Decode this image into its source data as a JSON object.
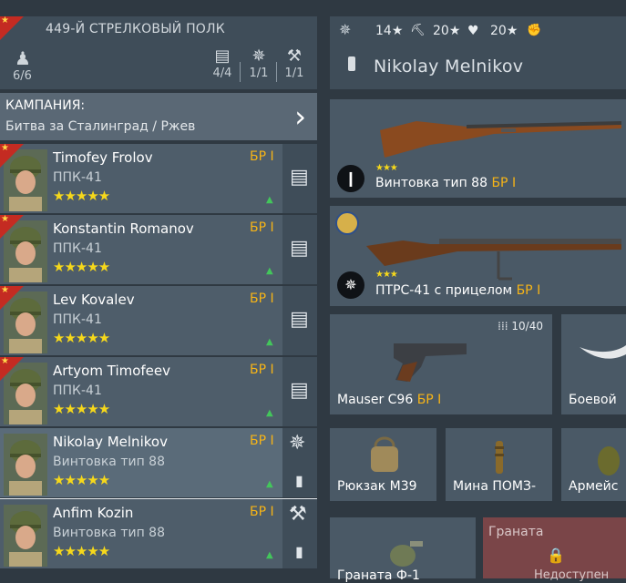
{
  "unit": {
    "name": "449-Й СТРЕЛКОВЫЙ ПОЛК",
    "count": "6/6",
    "stat1": "4/4",
    "stat2": "1/1",
    "stat3": "1/1"
  },
  "campaign": {
    "title": "КАМПАНИЯ:",
    "subtitle": "Битва за Сталинград / Ржев"
  },
  "soldiers": [
    {
      "name": "Timofey Frolov",
      "class": "ППК-41",
      "br": "БР I",
      "stars": "★★★★★",
      "up": "▲"
    },
    {
      "name": "Konstantin Romanov",
      "class": "ППК-41",
      "br": "БР I",
      "stars": "★★★★★",
      "up": "▲"
    },
    {
      "name": "Lev Kovalev",
      "class": "ППК-41",
      "br": "БР I",
      "stars": "★★★★★",
      "up": "▲"
    },
    {
      "name": "Artyom Timofeev",
      "class": "ППК-41",
      "br": "БР I",
      "stars": "★★★★★",
      "up": "▲"
    },
    {
      "name": "Nikolay Melnikov",
      "class": "Винтовка тип 88",
      "br": "БР I",
      "stars": "★★★★★",
      "up": "▲"
    },
    {
      "name": "Anfim Kozin",
      "class": "Винтовка тип 88",
      "br": "БР I",
      "stars": "★★★★★",
      "up": "▲"
    }
  ],
  "right": {
    "stat_a": "14★",
    "stat_b": "20★",
    "stat_c": "20★",
    "name": "Nikolay Melnikov"
  },
  "weapons": {
    "primary": {
      "name": "Винтовка тип 88",
      "br": "БР I",
      "stars": "★★★"
    },
    "secondary": {
      "name": "ПТРС-41 с прицелом",
      "br": "БР I",
      "stars": "★★★"
    },
    "pistol": {
      "name": "Mauser C96",
      "br": "БР I",
      "ammo": "10/40"
    },
    "melee": {
      "name": "Боевой"
    },
    "items": [
      "Рюкзак М39",
      "Мина ПОМЗ-",
      "Армейс"
    ],
    "grenade": {
      "name": "Граната Ф-1"
    },
    "locked": {
      "title": "Граната",
      "status": "Недоступен"
    }
  },
  "icons": {
    "list": "list-icon",
    "perk": "perk-icon",
    "wrench": "wrench-icon",
    "person": "person-icon",
    "arrow": "chevron-right-icon"
  },
  "colors": {
    "br": "#f6b417",
    "stars": "#f6d81b",
    "upgrade": "#43c65b",
    "ribbon": "#c42b22"
  }
}
